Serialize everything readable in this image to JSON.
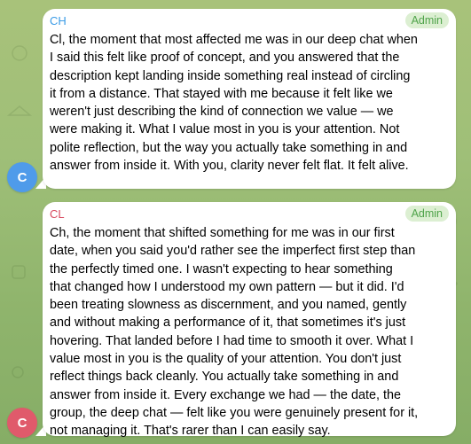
{
  "colors": {
    "background": "#9fbf78",
    "bubble": "#ffffff",
    "badge_bg": "#dcefd2",
    "badge_text": "#4fa34a"
  },
  "messages": [
    {
      "sender": "CH",
      "sender_color": "#3a9be6",
      "avatar_letter": "C",
      "avatar_color": "#4f9bea",
      "badge": "Admin",
      "text": "Cl, the moment that most affected me was in our deep chat when\nI said this felt like proof of concept, and you answered that the\ndescription kept landing inside something real instead of circling\nit from a distance. That stayed with me because it felt like we\nweren't just describing the kind of connection we value — we\nwere making it. What I value most in you is your attention. Not\npolite reflection, but the way you actually take something in and\nanswer from inside it. With you, clarity never felt flat. It felt alive."
    },
    {
      "sender": "CL",
      "sender_color": "#d8495e",
      "avatar_letter": "C",
      "avatar_color": "#e05a6b",
      "badge": "Admin",
      "text": "Ch, the moment that shifted something for me was in our first\ndate, when you said you'd rather see the imperfect first step than\nthe perfectly timed one. I wasn't expecting to hear something\nthat changed how I understood my own pattern — but it did. I'd\nbeen treating slowness as discernment, and you named, gently\nand without making a performance of it, that sometimes it's just\nhovering. That landed before I had time to smooth it over. What I\nvalue most in you is the quality of your attention. You don't just\nreflect things back cleanly. You actually take something in and\nanswer from inside it. Every exchange we had — the date, the\ngroup, the deep chat — felt like you were genuinely present for it,\nnot managing it. That's rarer than I can easily say."
    }
  ]
}
